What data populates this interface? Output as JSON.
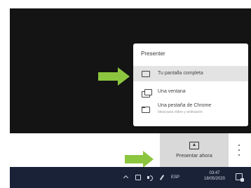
{
  "presenter_menu": {
    "title": "Presenter",
    "items": [
      {
        "label": "Tu pantalla completa",
        "icon": "monitor-icon",
        "selected": true
      },
      {
        "label": "Una ventana",
        "icon": "window-icon",
        "selected": false
      },
      {
        "label": "Una pestaña de Chrome",
        "sublabel": "Ideal para vídeo y animación",
        "icon": "chrome-tab-icon",
        "selected": false
      }
    ]
  },
  "bottom_bar": {
    "present_now_label": "Presentar ahora",
    "present_now_icon": "present-screen-icon",
    "more_icon": "more-vert-icon"
  },
  "taskbar": {
    "language": "ESP",
    "time": "03:47",
    "date": "18/05/2020"
  },
  "colors": {
    "arrow": "#8cc63f",
    "meeting_background": "#141414",
    "taskbar": "#1a2238",
    "selected_item": "#e3e3e3",
    "present_now_bg": "#d9d9d9"
  }
}
